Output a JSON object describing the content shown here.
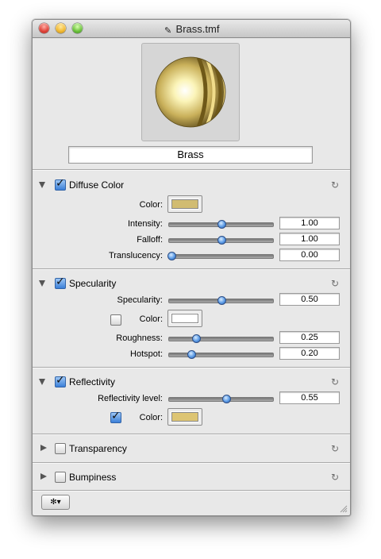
{
  "window": {
    "title": "Brass.tmf",
    "doc_icon": "document-icon"
  },
  "preview": {
    "name": "Brass"
  },
  "sections": {
    "diffuse": {
      "label": "Diffuse Color",
      "enabled": true,
      "expanded": true,
      "color_label": "Color:",
      "color": "#d1bc72",
      "intensity": {
        "label": "Intensity:",
        "value": "1.00",
        "fraction": 0.5
      },
      "falloff": {
        "label": "Falloff:",
        "value": "1.00",
        "fraction": 0.5
      },
      "translucency": {
        "label": "Translucency:",
        "value": "0.00",
        "fraction": 0.0
      }
    },
    "specularity": {
      "label": "Specularity",
      "enabled": true,
      "expanded": true,
      "specularity": {
        "label": "Specularity:",
        "value": "0.50",
        "fraction": 0.5
      },
      "color_label": "Color:",
      "color_enabled": false,
      "color": "#ffffff",
      "roughness": {
        "label": "Roughness:",
        "value": "0.25",
        "fraction": 0.25
      },
      "hotspot": {
        "label": "Hotspot:",
        "value": "0.20",
        "fraction": 0.2
      }
    },
    "reflectivity": {
      "label": "Reflectivity",
      "enabled": true,
      "expanded": true,
      "level": {
        "label": "Reflectivity level:",
        "value": "0.55",
        "fraction": 0.55
      },
      "color_label": "Color:",
      "color_enabled": true,
      "color": "#ddc574"
    },
    "transparency": {
      "label": "Transparency",
      "enabled": false,
      "expanded": false
    },
    "bumpiness": {
      "label": "Bumpiness",
      "enabled": false,
      "expanded": false
    }
  },
  "footer": {
    "action_label": "✻▾"
  },
  "icons": {
    "reset": "refresh-icon",
    "gear": "gear-icon",
    "grip": "resize-grip-icon"
  }
}
